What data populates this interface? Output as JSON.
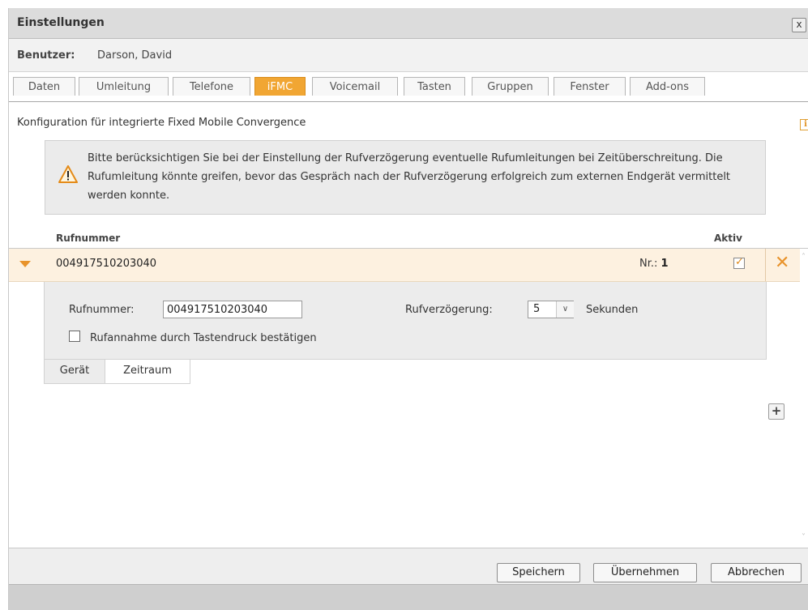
{
  "window": {
    "title": "Einstellungen",
    "close_glyph": "x"
  },
  "user": {
    "label": "Benutzer:",
    "name": "Darson, David"
  },
  "tabs": [
    {
      "label": "Daten"
    },
    {
      "label": "Umleitung"
    },
    {
      "label": "Telefone"
    },
    {
      "label": "iFMC",
      "active": true
    },
    {
      "label": "Voicemail"
    },
    {
      "label": "Tasten"
    },
    {
      "label": "Gruppen"
    },
    {
      "label": "Fenster"
    },
    {
      "label": "Add-ons"
    }
  ],
  "subtitle": "Konfiguration für integrierte Fixed Mobile Convergence",
  "info_icon": {
    "icon": "info-icon",
    "glyph": "i"
  },
  "warning": {
    "icon": "warning-icon",
    "text": "Bitte berücksichtigen Sie bei der Einstellung der Rufverzögerung eventuelle Rufumleitungen bei Zeitüberschreitung. Die Rufumleitung könnte greifen, bevor das Gespräch nach der Rufverzögerung erfolgreich zum externen Endgerät vermittelt werden konnte."
  },
  "grid": {
    "columns": {
      "rufnummer": "Rufnummer",
      "aktiv": "Aktiv"
    },
    "rows": [
      {
        "number": "004917510203040",
        "nr_label": "Nr.:",
        "nr_value": "1",
        "active": true,
        "expanded": true
      }
    ]
  },
  "detail": {
    "rufnummer_label": "Rufnummer:",
    "rufnummer_value": "004917510203040",
    "delay_label": "Rufverzögerung:",
    "delay_value": "5",
    "delay_unit": "Sekunden",
    "confirm_label": "Rufannahme durch Tastendruck bestätigen",
    "confirm_checked": false,
    "subtabs": [
      {
        "label": "Gerät",
        "active": true
      },
      {
        "label": "Zeitraum"
      }
    ]
  },
  "add_button": {
    "glyph": "+"
  },
  "footer": {
    "save": "Speichern",
    "apply": "Übernehmen",
    "cancel": "Abbrechen"
  },
  "colors": {
    "accent": "#f1a633",
    "selected_row": "#fdf1e0",
    "panel": "#ececec"
  }
}
